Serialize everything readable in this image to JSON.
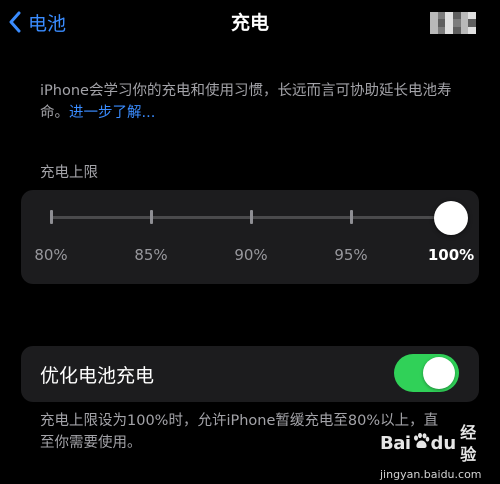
{
  "nav": {
    "back_label": "电池",
    "title": "充电"
  },
  "description": {
    "text": "iPhone会学习你的充电和使用习惯，长远而言可协助延长电池寿命。",
    "link_label": "进一步了解..."
  },
  "charge_limit": {
    "section_label": "充电上限",
    "options": [
      "80%",
      "85%",
      "90%",
      "95%",
      "100%"
    ],
    "selected_index": 4,
    "selected_value": "100%"
  },
  "optimized_charging": {
    "label": "优化电池充电",
    "enabled": true
  },
  "footer": {
    "text": "充电上限设为100%时，允许iPhone暂缓充电至80%以上，直至你需要使用。"
  },
  "watermark": {
    "brand_a": "Bai",
    "brand_b": "du",
    "brand_cn": "经验",
    "url": "jingyan.baidu.com"
  },
  "colors": {
    "accent": "#3a8cff",
    "toggle_on": "#30d158",
    "card_bg": "#1c1c1e",
    "secondary_text": "#a3a3a8"
  }
}
